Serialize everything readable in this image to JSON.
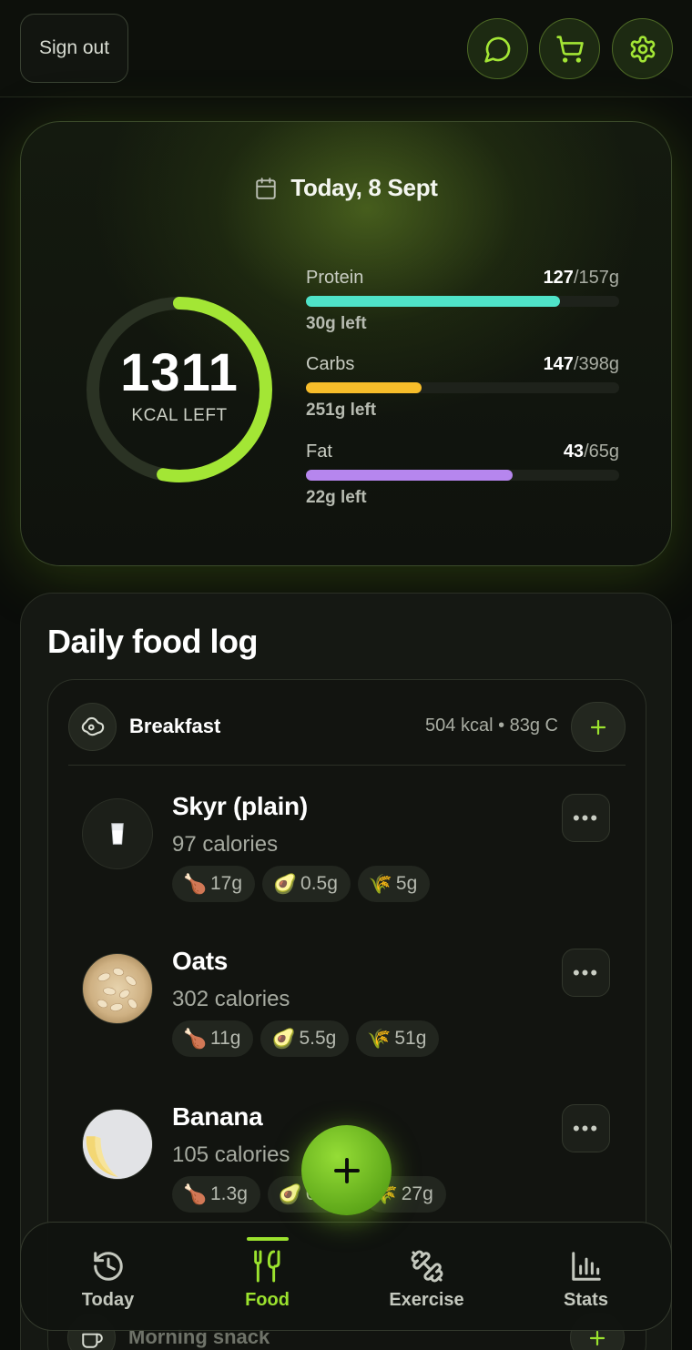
{
  "header": {
    "signout_label": "Sign out",
    "icons": [
      "chat-icon",
      "cart-icon",
      "settings-icon"
    ]
  },
  "summary": {
    "date": "Today, 8 Sept",
    "kcal_left": "1311",
    "kcal_label": "KCAL LEFT",
    "kcal_progress_fraction": 0.53,
    "macros": [
      {
        "name": "Protein",
        "eaten": "127",
        "goal": "/157g",
        "left": "30g left",
        "fraction": 0.81,
        "color": "#4fe3c8"
      },
      {
        "name": "Carbs",
        "eaten": "147",
        "goal": "/398g",
        "left": "251g left",
        "fraction": 0.37,
        "color": "#f7bd2a"
      },
      {
        "name": "Fat",
        "eaten": "43",
        "goal": "/65g",
        "left": "22g left",
        "fraction": 0.66,
        "color": "#b686ee"
      }
    ],
    "colors": {
      "ring": "#a3e635",
      "accent": "#9be22e"
    }
  },
  "food_log": {
    "title": "Daily food log",
    "meals": [
      {
        "name": "Breakfast",
        "stats": "504 kcal • 83g C",
        "items": [
          {
            "name": "Skyr (plain)",
            "calories": "97 calories",
            "protein": "17g",
            "fat": "0.5g",
            "carbs": "5g",
            "icon": "milk-glass-icon"
          },
          {
            "name": "Oats",
            "calories": "302 calories",
            "protein": "11g",
            "fat": "5.5g",
            "carbs": "51g",
            "icon": "oats-image"
          },
          {
            "name": "Banana",
            "calories": "105 calories",
            "protein": "1.3g",
            "fat": "0.4g",
            "carbs": "27g",
            "icon": "banana-image"
          }
        ]
      },
      {
        "name": "Morning snack"
      }
    ]
  },
  "nav": {
    "items": [
      {
        "label": "Today",
        "icon": "history-clock-icon"
      },
      {
        "label": "Food",
        "icon": "food-icon",
        "active": true
      },
      {
        "label": "Exercise",
        "icon": "dumbbell-icon"
      },
      {
        "label": "Stats",
        "icon": "bar-chart-icon"
      }
    ]
  }
}
